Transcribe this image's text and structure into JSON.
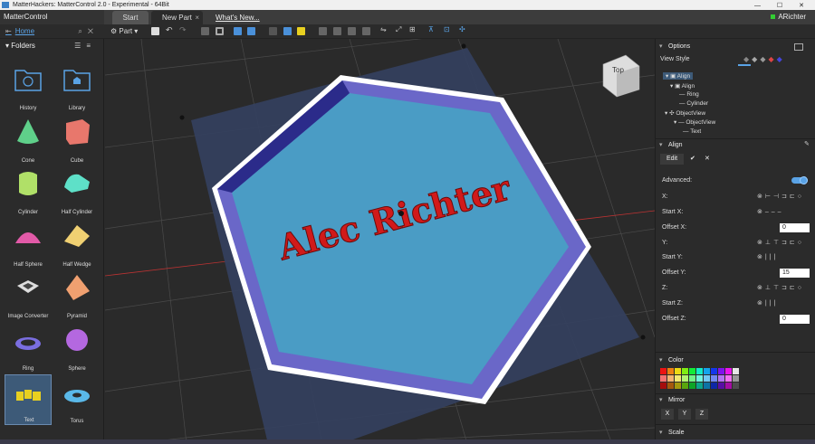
{
  "window": {
    "title": "MatterHackers: MatterControl 2.0 - Experimental - 64Bit"
  },
  "app": {
    "name": "MatterControl"
  },
  "tabs": [
    {
      "label": "Start"
    },
    {
      "label": "New Part"
    },
    {
      "label": "What's New..."
    }
  ],
  "user": {
    "name": "ARichter"
  },
  "nav": {
    "home": "Home",
    "folders": "Folders"
  },
  "toolbar": {
    "part_menu": "Part"
  },
  "library": [
    {
      "label": "History",
      "icon": "history-folder-icon"
    },
    {
      "label": "Library",
      "icon": "library-folder-icon"
    },
    {
      "label": "Cone",
      "icon": "cone-icon"
    },
    {
      "label": "Cube",
      "icon": "cube-icon"
    },
    {
      "label": "Cylinder",
      "icon": "cylinder-icon"
    },
    {
      "label": "Half Cylinder",
      "icon": "half-cylinder-icon"
    },
    {
      "label": "Half Sphere",
      "icon": "half-sphere-icon"
    },
    {
      "label": "Half Wedge",
      "icon": "half-wedge-icon"
    },
    {
      "label": "Image Converter",
      "icon": "image-converter-icon"
    },
    {
      "label": "Pyramid",
      "icon": "pyramid-icon"
    },
    {
      "label": "Ring",
      "icon": "ring-icon"
    },
    {
      "label": "Sphere",
      "icon": "sphere-icon"
    },
    {
      "label": "Text",
      "icon": "text-icon"
    },
    {
      "label": "Torus",
      "icon": "torus-icon"
    }
  ],
  "scene": {
    "text": "Alec Richter",
    "view_cube": "Top"
  },
  "options": {
    "title": "Options",
    "view_style": "View Style",
    "tree": [
      "Align",
      "Align",
      "Ring",
      "Cylinder",
      "ObjectView",
      "ObjectView",
      "Text"
    ]
  },
  "align": {
    "title": "Align",
    "edit": "Edit",
    "advanced": "Advanced:",
    "x": "X:",
    "start_x": "Start X:",
    "offset_x": "Offset X:",
    "offset_x_value": "0",
    "y": "Y:",
    "start_y": "Start Y:",
    "offset_y": "Offset Y:",
    "offset_y_value": "15",
    "z": "Z:",
    "start_z": "Start Z:",
    "offset_z": "Offset Z:",
    "offset_z_value": "0"
  },
  "color": {
    "title": "Color"
  },
  "mirror": {
    "title": "Mirror",
    "buttons": [
      "X",
      "Y",
      "Z"
    ]
  },
  "scale": {
    "title": "Scale"
  },
  "colors": {
    "accent": "#5aa3e6",
    "hex_fill": "#4a9cc5",
    "hex_rim": "#6a67c8",
    "text_red": "#d11a1a"
  }
}
